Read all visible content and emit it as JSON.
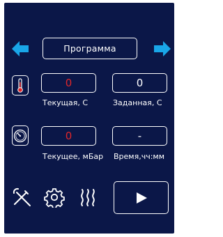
{
  "header": {
    "program_label": "Программа",
    "prev_icon": "arrow-left-icon",
    "next_icon": "arrow-right-icon"
  },
  "temperature": {
    "icon": "thermometer-icon",
    "current_value": "0",
    "current_label": "Текущая, С",
    "set_value": "0",
    "set_label": "Заданная, С"
  },
  "pressure": {
    "icon": "pressure-gauge-icon",
    "current_value": "0",
    "current_label": "Текущее, мБар",
    "time_value": "-",
    "time_label": "Время,чч:мм"
  },
  "toolbar": {
    "tools_icon": "tools-icon",
    "settings_icon": "gear-icon",
    "heating_icon": "heating-icon",
    "play_icon": "play-icon"
  },
  "colors": {
    "background": "#0b1748",
    "accent": "#19a6e8",
    "value_red": "#e0262a",
    "thermo_red": "#e0262a",
    "text": "#ffffff"
  }
}
